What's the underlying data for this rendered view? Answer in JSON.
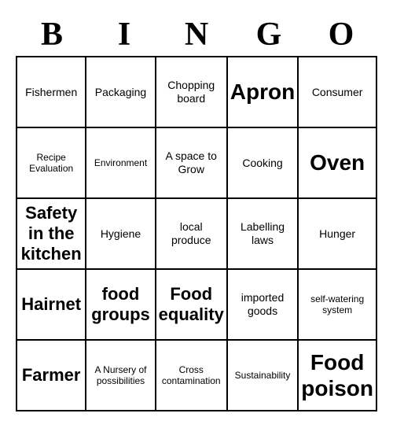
{
  "header": {
    "letters": [
      "B",
      "I",
      "N",
      "G",
      "O"
    ]
  },
  "cells": [
    {
      "text": "Fishermen",
      "size": "medium"
    },
    {
      "text": "Packaging",
      "size": "medium"
    },
    {
      "text": "Chopping board",
      "size": "medium"
    },
    {
      "text": "Apron",
      "size": "xlarge"
    },
    {
      "text": "Consumer",
      "size": "medium"
    },
    {
      "text": "Recipe Evaluation",
      "size": "small"
    },
    {
      "text": "Environment",
      "size": "small"
    },
    {
      "text": "A space to Grow",
      "size": "medium"
    },
    {
      "text": "Cooking",
      "size": "medium"
    },
    {
      "text": "Oven",
      "size": "xlarge"
    },
    {
      "text": "Safety in the kitchen",
      "size": "large"
    },
    {
      "text": "Hygiene",
      "size": "medium"
    },
    {
      "text": "local produce",
      "size": "medium"
    },
    {
      "text": "Labelling laws",
      "size": "medium"
    },
    {
      "text": "Hunger",
      "size": "medium"
    },
    {
      "text": "Hairnet",
      "size": "large"
    },
    {
      "text": "food groups",
      "size": "large"
    },
    {
      "text": "Food equality",
      "size": "large"
    },
    {
      "text": "imported goods",
      "size": "medium"
    },
    {
      "text": "self-watering system",
      "size": "small"
    },
    {
      "text": "Farmer",
      "size": "large"
    },
    {
      "text": "A Nursery of possibilities",
      "size": "small"
    },
    {
      "text": "Cross contamination",
      "size": "small"
    },
    {
      "text": "Sustainability",
      "size": "small"
    },
    {
      "text": "Food poison",
      "size": "xlarge"
    }
  ]
}
